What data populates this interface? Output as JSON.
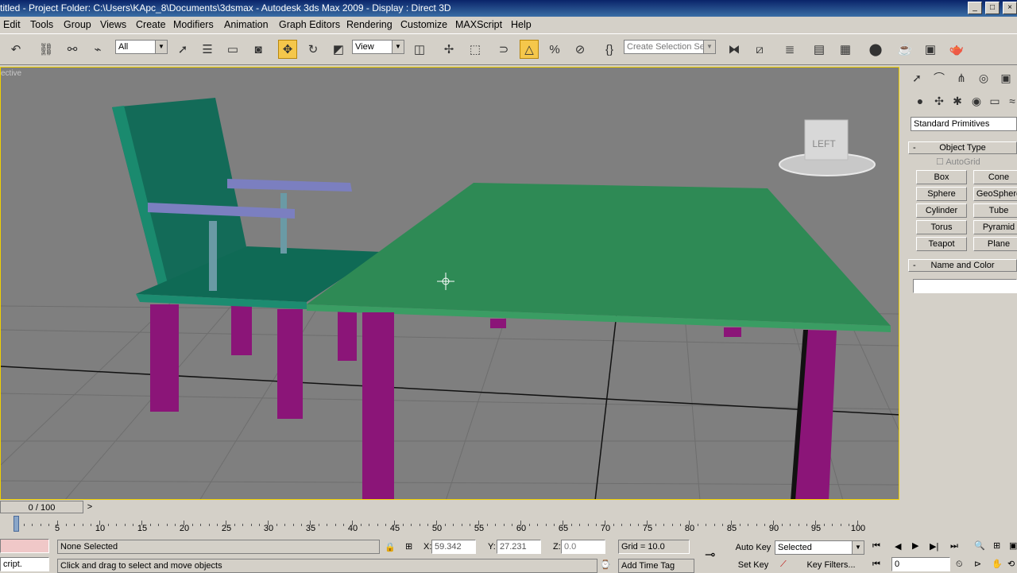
{
  "window": {
    "title": "titled    - Project Folder: C:\\Users\\KApc_8\\Documents\\3dsmax    - Autodesk 3ds Max  2009     - Display : Direct 3D"
  },
  "menu": [
    "Edit",
    "Tools",
    "Group",
    "Views",
    "Create",
    "Modifiers",
    "Animation",
    "Graph Editors",
    "Rendering",
    "Customize",
    "MAXScript",
    "Help"
  ],
  "toolbar": {
    "selection_filter": "All",
    "coord_system": "View",
    "named_selection_placeholder": "Create Selection Set"
  },
  "viewport": {
    "label": "ective",
    "viewcube_face": "LEFT"
  },
  "command_panel": {
    "category": "Standard Primitives",
    "object_type_header": "Object Type",
    "autogrid_label": "AutoGrid",
    "buttons": [
      "Box",
      "Cone",
      "Sphere",
      "GeoSphere",
      "Cylinder",
      "Tube",
      "Torus",
      "Pyramid",
      "Teapot",
      "Plane"
    ],
    "name_color_header": "Name and Color",
    "name_value": ""
  },
  "timeline": {
    "slider_label": "0 / 100",
    "ticks": [
      "5",
      "10",
      "15",
      "20",
      "25",
      "30",
      "35",
      "40",
      "45",
      "50",
      "55",
      "60",
      "65",
      "70",
      "75",
      "80",
      "85",
      "90",
      "95",
      "100"
    ]
  },
  "status": {
    "maxscript_text": "cript.",
    "selection_status": "None Selected",
    "prompt": "Click and drag to select and move objects",
    "x_label": "X:",
    "x_value": "59.342",
    "y_label": "Y:",
    "y_value": "27.231",
    "z_label": "Z:",
    "z_value": "0.0",
    "grid": "Grid = 10.0",
    "add_time_tag": "Add Time Tag",
    "auto_key": "Auto Key",
    "set_key": "Set Key",
    "key_mode": "Selected",
    "key_filters": "Key Filters...",
    "frame": "0"
  },
  "colors": {
    "chair_back": "#136b58",
    "table_top": "#2e8a55",
    "legs": "#8b1578",
    "arms": "#7b7fc0",
    "viewport_bg": "#7f7f7f"
  }
}
